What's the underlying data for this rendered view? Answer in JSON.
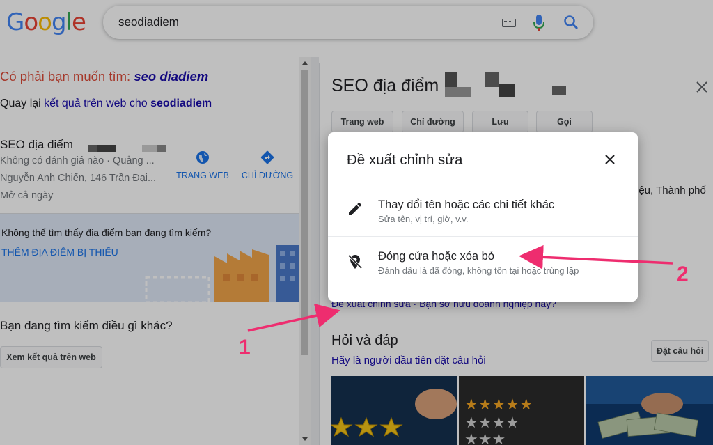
{
  "header": {
    "logo_letters": [
      "G",
      "o",
      "o",
      "g",
      "l",
      "e"
    ],
    "logo_colors": [
      "#4285f4",
      "#ea4335",
      "#fbbc05",
      "#4285f4",
      "#34a853",
      "#ea4335"
    ],
    "search_value": "seodiadiem"
  },
  "left": {
    "did_you_mean_prefix": "Có phải bạn muốn tìm: ",
    "did_you_mean_term": "seo diadiem",
    "back_prefix": "Quay lại ",
    "back_link": "kết quả trên web cho ",
    "back_term": "seodiadiem",
    "business": {
      "name": "SEO địa điểm",
      "rating": "Không có đánh giá nào · Quảng ...",
      "address": "Nguyễn Anh Chiến, 146 Trần Đại...",
      "hours": "Mở cả ngày",
      "website_label": "TRANG WEB",
      "directions_label": "CHỈ ĐƯỜNG"
    },
    "not_found_text": "Không thể tìm thấy địa điểm bạn đang tìm kiếm?",
    "add_missing_link": "THÊM ĐỊA ĐIỂM BỊ THIẾU",
    "other_question": "Bạn đang tìm kiếm điều gì khác?",
    "web_results_button": "Xem kết quả trên web"
  },
  "right": {
    "title": "SEO địa điểm",
    "buttons": [
      "Trang web",
      "Chỉ đường",
      "Lưu",
      "Gọi"
    ],
    "address_fragment": "iệu, Thành phố",
    "links": "Đề xuất chỉnh sửa · Bạn sở hữu doanh nghiệp này?",
    "qa_title": "Hỏi và đáp",
    "ask_button": "Đặt câu hỏi",
    "first_to_ask": "Hãy là người đầu tiên đặt câu hỏi"
  },
  "dialog": {
    "title": "Đề xuất chỉnh sửa",
    "options": [
      {
        "title": "Thay đổi tên hoặc các chi tiết khác",
        "subtitle": "Sửa tên, vị trí, giờ, v.v.",
        "icon": "pencil-icon"
      },
      {
        "title": "Đóng cửa hoặc xóa bỏ",
        "subtitle": "Đánh dấu là đã đóng, không tồn tại hoặc trùng lặp",
        "icon": "closed-place-icon"
      }
    ]
  },
  "annotations": {
    "label_1": "1",
    "label_2": "2",
    "color": "#ee2d6f"
  }
}
